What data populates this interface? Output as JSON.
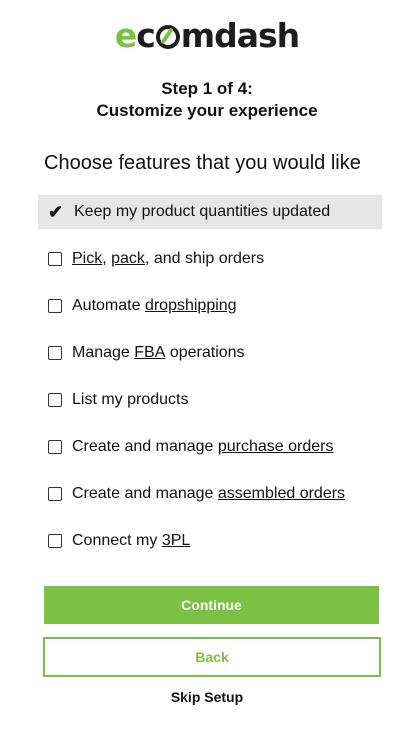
{
  "brand": {
    "logo_letters": [
      "e",
      "c",
      "o",
      "mdash"
    ],
    "accent_color": "#7bc143",
    "text_color": "#1d1d1d"
  },
  "header": {
    "step": "Step 1 of 4:",
    "title": "Customize your experience"
  },
  "question": "Choose features that you would like",
  "options": [
    {
      "selected": true,
      "parts": [
        "Keep my product quantities updated"
      ]
    },
    {
      "selected": false,
      "parts": [
        "Pick",
        ", ",
        "pack",
        ", and ship orders"
      ]
    },
    {
      "selected": false,
      "parts": [
        "Automate ",
        "dropshipping"
      ]
    },
    {
      "selected": false,
      "parts": [
        "Manage ",
        "FBA",
        " operations"
      ]
    },
    {
      "selected": false,
      "parts": [
        "List my products"
      ]
    },
    {
      "selected": false,
      "parts": [
        "Create and manage ",
        "purchase orders"
      ]
    },
    {
      "selected": false,
      "parts": [
        "Create and manage ",
        "assembled orders"
      ]
    },
    {
      "selected": false,
      "parts": [
        "Connect my ",
        "3PL"
      ]
    }
  ],
  "buttons": {
    "continue": "Continue",
    "back": "Back",
    "skip": "Skip Setup"
  },
  "icons": {
    "selected": "checkmark-icon",
    "unselected": "checkbox-empty-icon"
  }
}
